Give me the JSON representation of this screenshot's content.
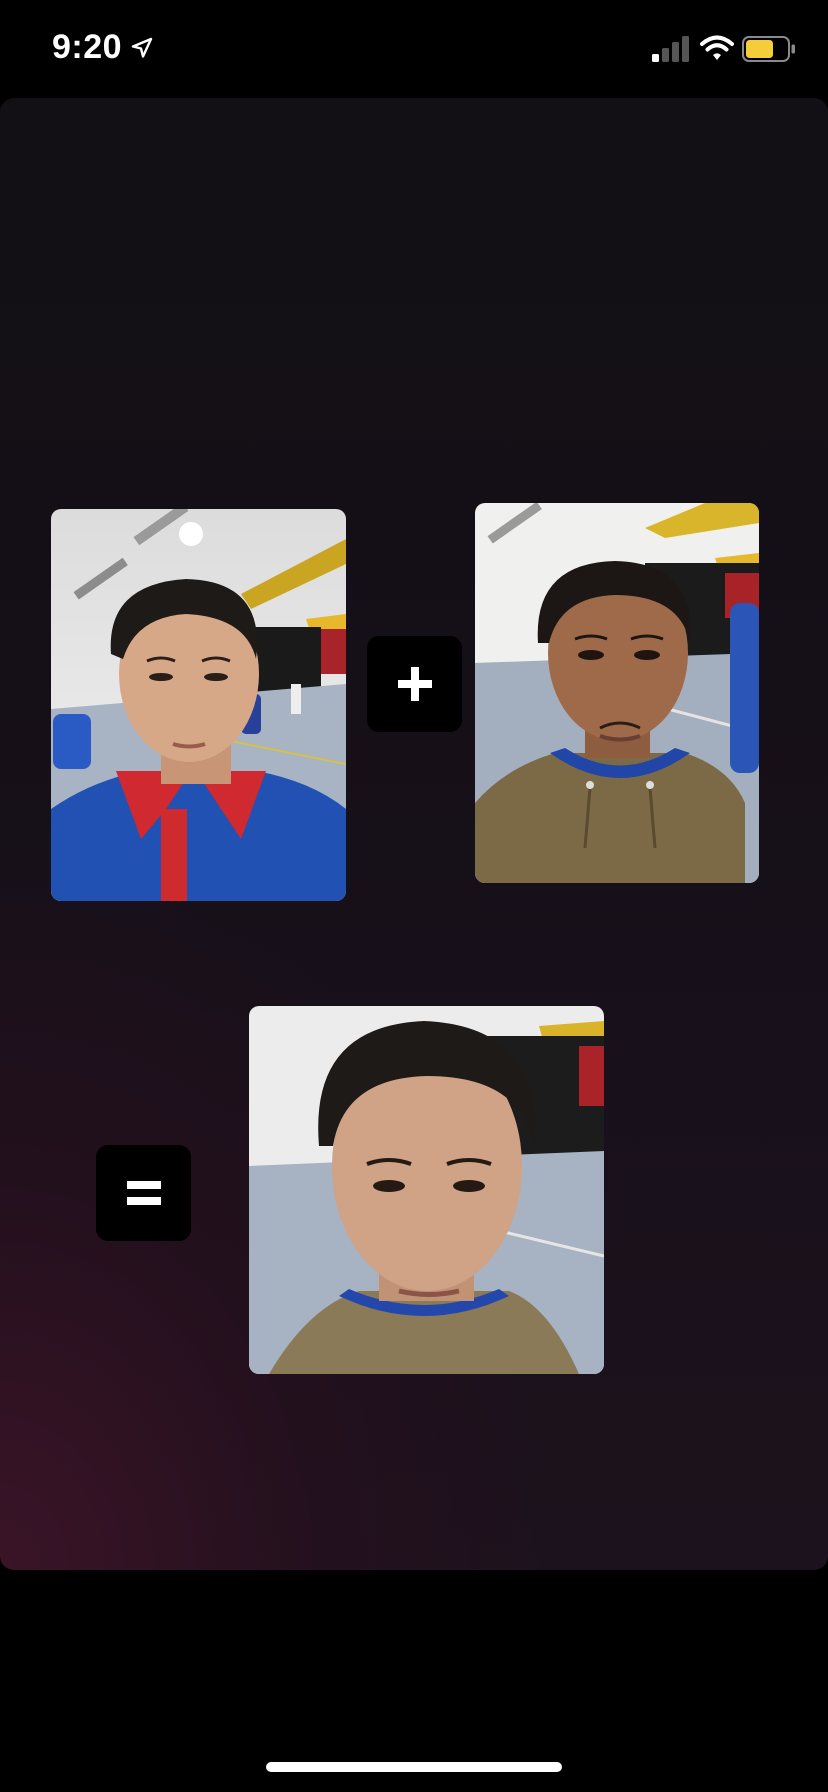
{
  "status_bar": {
    "time": "9:20",
    "icons": [
      "location-arrow-icon",
      "cellular-signal-icon",
      "wifi-icon",
      "battery-icon"
    ],
    "battery_color": "#f5cc3a"
  },
  "main": {
    "photos": [
      {
        "name": "input-photo-1",
        "description_icon": "face-photo"
      },
      {
        "name": "input-photo-2",
        "description_icon": "face-photo"
      },
      {
        "name": "result-photo",
        "description_icon": "face-photo"
      }
    ],
    "operators": {
      "plus_icon": "plus-icon",
      "equals_icon": "equals-icon"
    }
  },
  "colors": {
    "background": "#000000",
    "card_top": "#121014",
    "card_glow": "#3c1428",
    "operator_bg": "#000000",
    "operator_fg": "#ffffff"
  }
}
